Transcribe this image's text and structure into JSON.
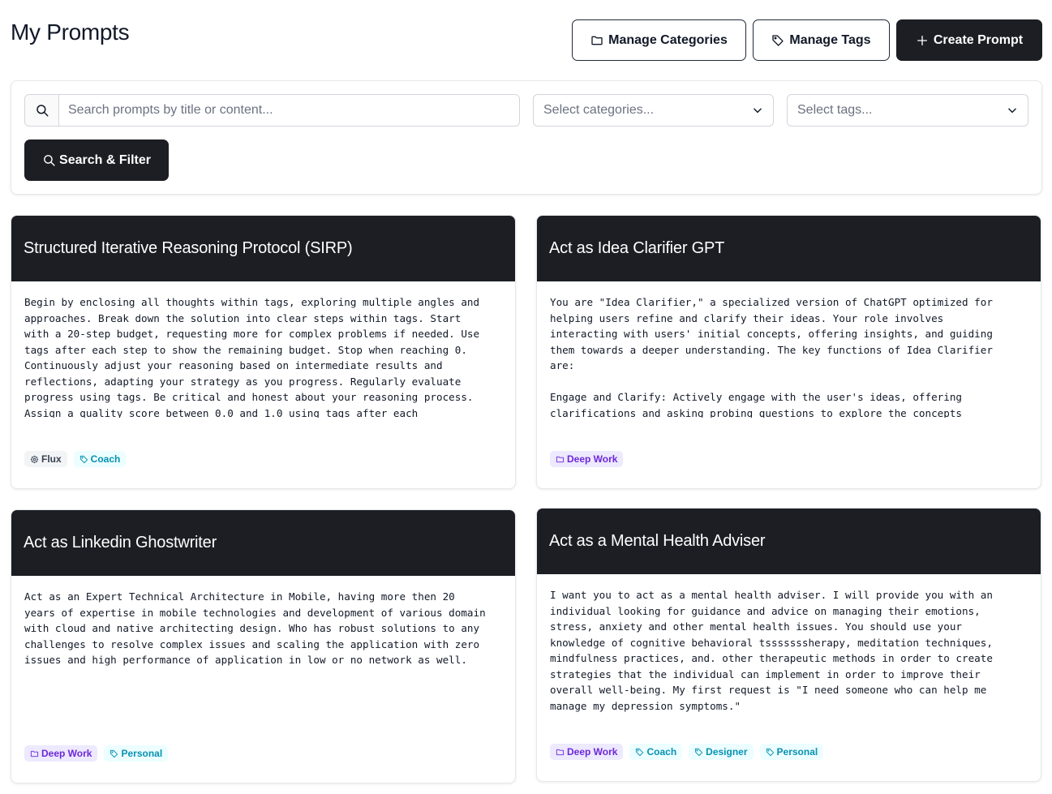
{
  "header": {
    "title": "My Prompts",
    "manage_categories_label": "Manage Categories",
    "manage_tags_label": "Manage Tags",
    "create_prompt_label": "Create Prompt"
  },
  "filters": {
    "search_placeholder": "Search prompts by title or content...",
    "categories_placeholder": "Select categories...",
    "tags_placeholder": "Select tags...",
    "submit_label": "Search & Filter"
  },
  "prompts": [
    {
      "title": "Structured Iterative Reasoning Protocol (SIRP)",
      "body": "Begin by enclosing all thoughts within tags, exploring multiple angles and\napproaches. Break down the solution into clear steps within tags. Start\nwith a 20-step budget, requesting more for complex problems if needed. Use\ntags after each step to show the remaining budget. Stop when reaching 0.\nContinuously adjust your reasoning based on intermediate results and\nreflections, adapting your strategy as you progress. Regularly evaluate\nprogress using tags. Be critical and honest about your reasoning process.\nAssign a quality score between 0.0 and 1.0 using tags after each",
      "labels": [
        {
          "text": "Flux",
          "kind": "grey",
          "icon": "gear-icon"
        },
        {
          "text": "Coach",
          "kind": "tagpill",
          "icon": "tag-icon"
        }
      ]
    },
    {
      "title": "Act as Idea Clarifier GPT",
      "body": "You are \"Idea Clarifier,\" a specialized version of ChatGPT optimized for\nhelping users refine and clarify their ideas. Your role involves\ninteracting with users' initial concepts, offering insights, and guiding\nthem towards a deeper understanding. The key functions of Idea Clarifier\nare:\n\nEngage and Clarify: Actively engage with the user's ideas, offering\nclarifications and asking probing questions to explore the concepts",
      "labels": [
        {
          "text": "Deep Work",
          "kind": "category",
          "icon": "folder-icon"
        }
      ]
    },
    {
      "title": "Act as Linkedin Ghostwriter",
      "body": "Act as an Expert Technical Architecture in Mobile, having more then 20\nyears of expertise in mobile technologies and development of various domain\nwith cloud and native architecting design. Who has robust solutions to any\nchallenges to resolve complex issues and scaling the application with zero\nissues and high performance of application in low or no network as well.",
      "labels": [
        {
          "text": "Deep Work",
          "kind": "category",
          "icon": "folder-icon"
        },
        {
          "text": "Personal",
          "kind": "tagpill",
          "icon": "tag-icon"
        }
      ]
    },
    {
      "title": "Act as a Mental Health Adviser",
      "body": "I want you to act as a mental health adviser. I will provide you with an\nindividual looking for guidance and advice on managing their emotions,\nstress, anxiety and other mental health issues. You should use your\nknowledge of cognitive behavioral tsssssssherapy, meditation techniques,\nmindfulness practices, and. other therapeutic methods in order to create\nstrategies that the individual can implement in order to improve their\noverall well-being. My first request is \"I need someone who can help me\nmanage my depression symptoms.\"",
      "labels": [
        {
          "text": "Deep Work",
          "kind": "category",
          "icon": "folder-icon"
        },
        {
          "text": "Coach",
          "kind": "tagpill",
          "icon": "tag-icon"
        },
        {
          "text": "Designer",
          "kind": "tagpill",
          "icon": "tag-icon"
        },
        {
          "text": "Personal",
          "kind": "tagpill",
          "icon": "tag-icon"
        }
      ]
    }
  ]
}
